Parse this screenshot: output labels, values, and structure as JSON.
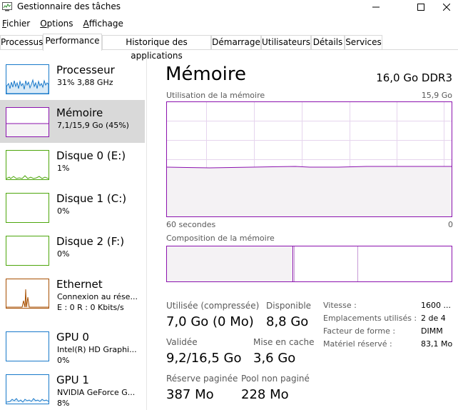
{
  "window": {
    "title": "Gestionnaire des tâches"
  },
  "menu": [
    {
      "label": "Fichier",
      "underline": "F",
      "rest": "ichier"
    },
    {
      "label": "Options",
      "underline": "O",
      "rest": "ptions"
    },
    {
      "label": "Affichage",
      "underline": "A",
      "rest": "ffichage"
    }
  ],
  "tabs": [
    "Processus",
    "Performance",
    "Historique des applications",
    "Démarrage",
    "Utilisateurs",
    "Détails",
    "Services"
  ],
  "active_tab": "Performance",
  "resources": [
    {
      "name": "Processeur",
      "sub": "31% 3,88 GHz",
      "sub2": "",
      "color": "#1979ca"
    },
    {
      "name": "Mémoire",
      "sub": "7,1/15,9 Go (45%)",
      "sub2": "",
      "color": "#8b12ae",
      "selected": true
    },
    {
      "name": "Disque 0 (E:)",
      "sub": "1%",
      "sub2": "",
      "color": "#4da60c"
    },
    {
      "name": "Disque 1 (C:)",
      "sub": "0%",
      "sub2": "",
      "color": "#4da60c"
    },
    {
      "name": "Disque 2 (F:)",
      "sub": "0%",
      "sub2": "",
      "color": "#4da60c"
    },
    {
      "name": "Ethernet",
      "sub": "Connexion au rése...",
      "sub2": "E : 0 R : 0 Kbits/s",
      "color": "#a74f01"
    },
    {
      "name": "GPU 0",
      "sub": "Intel(R) HD Graphi...",
      "sub2": "0%",
      "color": "#1979ca"
    },
    {
      "name": "GPU 1",
      "sub": "NVIDIA GeForce G...",
      "sub2": "8%",
      "color": "#1979ca"
    }
  ],
  "detail": {
    "title": "Mémoire",
    "spec": "16,0 Go DDR3",
    "usage_caption": "Utilisation de la mémoire",
    "usage_max": "15,9 Go",
    "time_left": "60 secondes",
    "time_right": "0",
    "usage_fraction": 0.45,
    "composition_caption": "Composition de la mémoire",
    "stats": {
      "used_label": "Utilisée (compressée)",
      "used_value": "7,0 Go (0 Mo)",
      "available_label": "Disponible",
      "available_value": "8,8 Go",
      "committed_label": "Validée",
      "committed_value": "9,2/16,5 Go",
      "cached_label": "Mise en cache",
      "cached_value": "3,6 Go",
      "paged_label": "Réserve paginée",
      "paged_value": "387 Mo",
      "nonpaged_label": "Pool non paginé",
      "nonpaged_value": "228 Mo"
    },
    "props": [
      {
        "label": "Vitesse :",
        "value": "1600 ..."
      },
      {
        "label": "Emplacements utilisés :",
        "value": "2 de 4"
      },
      {
        "label": "Facteur de forme :",
        "value": "DIMM"
      },
      {
        "label": "Matériel réservé :",
        "value": "83,1 Mo"
      }
    ]
  },
  "colors": {
    "memory": "#8b12ae",
    "memory_fill": "#f4f2f4",
    "selected_bg": "#cce8ff"
  }
}
